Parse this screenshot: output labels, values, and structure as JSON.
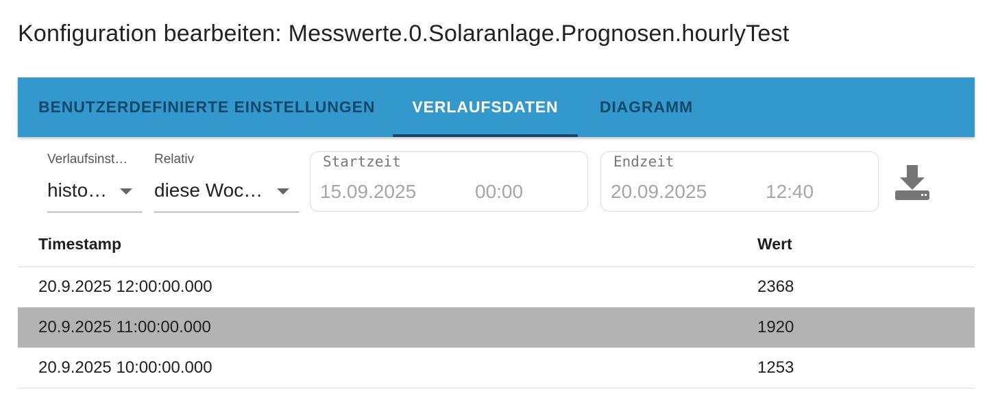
{
  "page": {
    "title": "Konfiguration bearbeiten: Messwerte.0.Solaranlage.Prognosen.hourlyTest"
  },
  "tabs": [
    {
      "label": "BENUTZERDEFINIERTE EINSTELLUNGEN",
      "active": false
    },
    {
      "label": "VERLAUFSDATEN",
      "active": true
    },
    {
      "label": "DIAGRAMM",
      "active": false
    }
  ],
  "colors": {
    "tabbar": "#3399cc",
    "tab_inactive_text": "#12496b",
    "tab_active_text": "#ffffff",
    "selected_row": "#b3b3b3"
  },
  "controls": {
    "history_select": {
      "label": "Verlaufsinst…",
      "value": "histo…"
    },
    "relative_select": {
      "label": "Relativ",
      "value": "diese Woc…"
    },
    "start": {
      "label": "Startzeit",
      "date": "15.09.2025",
      "time": "00:00"
    },
    "end": {
      "label": "Endzeit",
      "date": "20.09.2025",
      "time": "12:40"
    },
    "download_icon": "download-icon"
  },
  "table": {
    "headers": {
      "timestamp": "Timestamp",
      "value": "Wert"
    },
    "rows": [
      {
        "timestamp": "20.9.2025 12:00:00.000",
        "value": "2368",
        "selected": false
      },
      {
        "timestamp": "20.9.2025 11:00:00.000",
        "value": "1920",
        "selected": true
      },
      {
        "timestamp": "20.9.2025 10:00:00.000",
        "value": "1253",
        "selected": false
      }
    ]
  }
}
